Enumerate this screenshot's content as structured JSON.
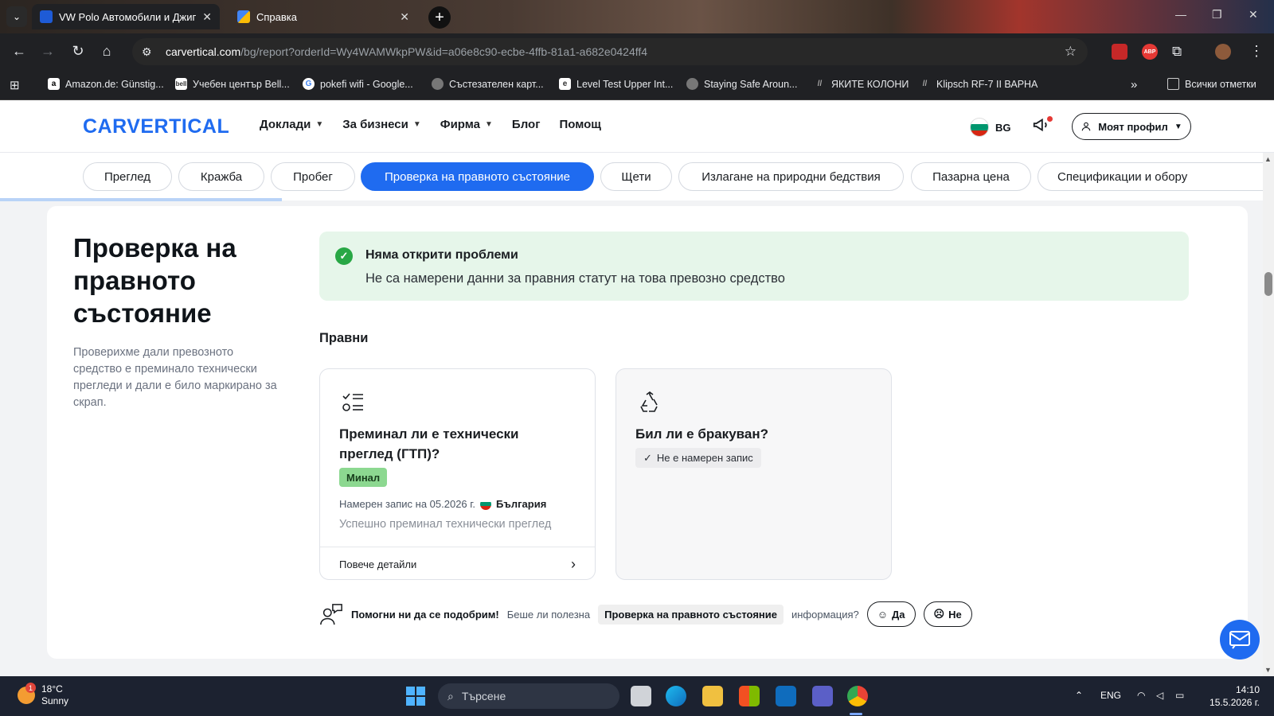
{
  "browser": {
    "tabs": [
      {
        "title": "VW Polo Автомобили и Джипс",
        "active": true
      },
      {
        "title": "Справка",
        "active": false
      }
    ],
    "url_host": "carvertical.com",
    "url_path": "/bg/report?orderId=Wy4WAMWkpPW&id=a06e8c90-ecbe-4ffb-81a1-a682e0424ff4",
    "bookmarks": [
      "Amazon.de: Günstig...",
      "Учебен център Bell...",
      "pokefi wifi - Google...",
      "Състезателен карт...",
      "Level Test Upper Int...",
      "Staying Safe Aroun...",
      "ЯКИТЕ КОЛОНИ",
      "Klipsch RF-7 II ВАРНА"
    ],
    "all_bookmarks": "Всички отметки"
  },
  "header": {
    "logo": "CARVERTICAL",
    "nav": [
      "Доклади",
      "За бизнеси",
      "Фирма",
      "Блог",
      "Помощ"
    ],
    "lang": "BG",
    "profile": "Моят профил"
  },
  "section_tabs": [
    "Преглед",
    "Кражба",
    "Пробег",
    "Проверка на правното състояние",
    "Щети",
    "Излагане на природни бедствия",
    "Пазарна цена",
    "Спецификации и обору"
  ],
  "section": {
    "title": "Проверка на правното състояние",
    "description": "Проверихме дали превозното средство е преминало технически прегледи и дали е било маркирано за скрап."
  },
  "banner": {
    "title": "Няма открити проблеми",
    "text": "Не са намерени данни за правния статут на това превозно средство"
  },
  "legal_label": "Правни",
  "inspection_card": {
    "title": "Преминал ли е технически преглед (ГТП)?",
    "badge": "Минал",
    "found_prefix": "Намерен запис на 05.2026 г.",
    "country": "България",
    "note": "Успешно преминал технически преглед",
    "more": "Повече детайли"
  },
  "scrap_card": {
    "title": "Бил ли е бракуван?",
    "badge": "Не е намерен запис"
  },
  "feedback": {
    "strong": "Помогни ни да се подобрим!",
    "question": "Беше ли полезна",
    "chip": "Проверка на правното състояние",
    "suffix": "информация?",
    "yes": "Да",
    "no": "Не"
  },
  "taskbar": {
    "temp": "18°C",
    "weather": "Sunny",
    "notif_count": "1",
    "search_placeholder": "Търсене",
    "lang": "ENG",
    "time": "14:10",
    "date": "15.5.2026 г."
  },
  "colors": {
    "accent": "#1f6bf0",
    "success_bg": "#e6f6ea",
    "success_icon": "#28a745",
    "badge_pass": "#8cd890"
  }
}
